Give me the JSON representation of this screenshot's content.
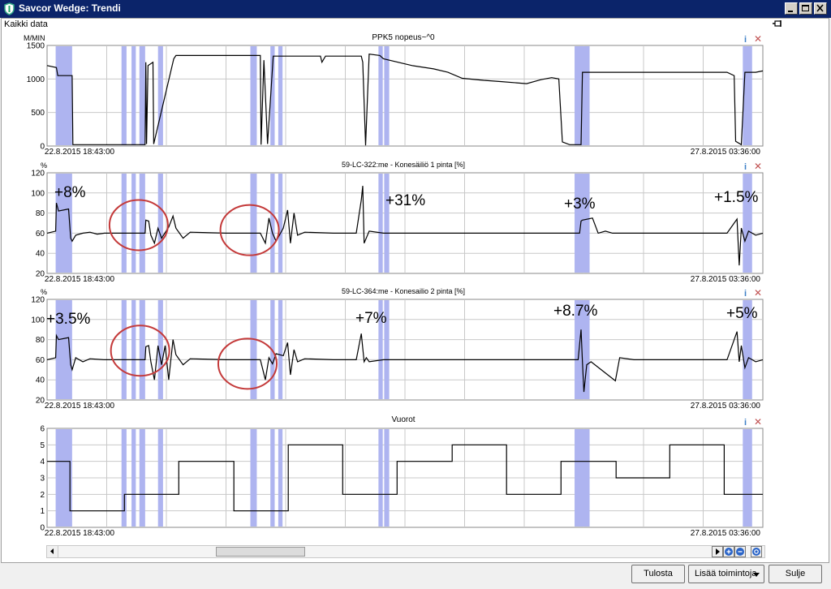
{
  "window": {
    "title": "Savcor Wedge: Trendi"
  },
  "header": {
    "data_label": "Kaikki data"
  },
  "charts": [
    {
      "title": "PPK5 nopeus~^0",
      "unit": "M/MIN",
      "yticks": [
        "1500",
        "1000",
        "500",
        "0"
      ],
      "ymin": 0,
      "ymax": 1500,
      "x_start": "22.8.2015 18:43:00",
      "x_end": "27.8.2015 03:36:00",
      "annotations": []
    },
    {
      "title": "59-LC-322:me - Konesäiliö 1 pinta [%]",
      "unit": "%",
      "yticks": [
        "120",
        "100",
        "80",
        "60",
        "40",
        "20"
      ],
      "ymin": 20,
      "ymax": 120,
      "x_start": "22.8.2015 18:43:00",
      "x_end": "27.8.2015 03:36:00",
      "annotations": [
        "+8%",
        "+31%",
        "+3%",
        "+1.5%"
      ]
    },
    {
      "title": "59-LC-364:me - Konesailio 2 pinta [%]",
      "unit": "%",
      "yticks": [
        "120",
        "100",
        "80",
        "60",
        "40",
        "20"
      ],
      "ymin": 20,
      "ymax": 120,
      "x_start": "22.8.2015 18:43:00",
      "x_end": "27.8.2015 03:36:00",
      "annotations": [
        "+3.5%",
        "+7%",
        "+8.7%",
        "+5%"
      ]
    },
    {
      "title": "Vuorot",
      "unit": "",
      "yticks": [
        "6",
        "5",
        "4",
        "3",
        "2",
        "1",
        "0"
      ],
      "ymin": 0,
      "ymax": 6,
      "x_start": "22.8.2015 18:43:00",
      "x_end": "27.8.2015 03:36:00",
      "annotations": []
    }
  ],
  "chart_data": [
    {
      "type": "line",
      "title": "PPK5 nopeus~^0",
      "ylabel": "M/MIN",
      "ylim": [
        0,
        1500
      ],
      "x_range": [
        "22.8.2015 18:43:00",
        "27.8.2015 03:36:00"
      ],
      "x": [
        0,
        1.3,
        1.5,
        3.5,
        3.6,
        13.7,
        13.8,
        13.9,
        14.1,
        14.8,
        14.9,
        17.7,
        18,
        29.8,
        29.9,
        30.3,
        30.8,
        31.6,
        38.2,
        38.4,
        38.9,
        43.9,
        44.1,
        44.5,
        45,
        46.5,
        47,
        51,
        54,
        56,
        58,
        61,
        63.5,
        67,
        69,
        70.5,
        71.5,
        72,
        73,
        74.6,
        74.8,
        75.1,
        95,
        96,
        96.2,
        97,
        97.5,
        99,
        100
      ],
      "y": [
        1200,
        1170,
        1050,
        1050,
        20,
        20,
        1250,
        30,
        1200,
        1250,
        30,
        1300,
        1350,
        1350,
        20,
        1280,
        30,
        1340,
        1340,
        1250,
        1340,
        1340,
        1250,
        10,
        1370,
        1350,
        1300,
        1200,
        1150,
        1100,
        1010,
        980,
        960,
        930,
        990,
        1020,
        1000,
        60,
        20,
        20,
        1100,
        1100,
        1100,
        1050,
        70,
        20,
        1100,
        1100,
        1120
      ]
    },
    {
      "type": "line",
      "title": "59-LC-322:me - Konesäiliö 1 pinta [%]",
      "ylabel": "%",
      "ylim": [
        20,
        120
      ],
      "x_range": [
        "22.8.2015 18:43:00",
        "27.8.2015 03:36:00"
      ],
      "x": [
        0,
        1.2,
        1.3,
        1.6,
        3,
        3.3,
        3.5,
        4,
        5,
        6,
        7,
        8,
        10,
        13.7,
        13.8,
        14.2,
        14.5,
        15,
        15.5,
        16,
        17,
        17.6,
        18,
        19,
        20,
        25,
        29.8,
        30.5,
        31,
        31.5,
        32,
        33,
        33.6,
        34,
        34.5,
        35,
        36,
        40,
        43.2,
        43.9,
        44.1,
        44.3,
        45,
        47,
        60,
        74.4,
        74.6,
        74.8,
        76.2,
        77,
        78,
        79,
        95,
        96.4,
        96.7,
        97,
        97.5,
        98,
        99,
        100
      ],
      "y": [
        60,
        62,
        90,
        82,
        84,
        55,
        52,
        58,
        60,
        61,
        59,
        60,
        60,
        60,
        73,
        72,
        58,
        50,
        65,
        55,
        66,
        77,
        65,
        55,
        61,
        60,
        60,
        50,
        75,
        60,
        52,
        65,
        83,
        50,
        80,
        58,
        61,
        60,
        60,
        93,
        107,
        50,
        62,
        60,
        60,
        60,
        72,
        73,
        75,
        60,
        62,
        60,
        60,
        74,
        28,
        65,
        52,
        62,
        58,
        60
      ],
      "annotations": [
        "+8%",
        "+31%",
        "+3%",
        "+1.5%"
      ]
    },
    {
      "type": "line",
      "title": "59-LC-364:me - Konesailio 2 pinta [%]",
      "ylabel": "%",
      "ylim": [
        20,
        120
      ],
      "x_range": [
        "22.8.2015 18:43:00",
        "27.8.2015 03:36:00"
      ],
      "x": [
        0,
        1.2,
        1.3,
        1.6,
        3,
        3.3,
        3.5,
        4,
        5,
        6,
        8,
        10,
        13.7,
        13.8,
        14.2,
        14.5,
        15,
        15.5,
        16,
        16.5,
        17,
        17.6,
        18,
        19,
        20,
        25,
        29.8,
        30.5,
        31,
        31.5,
        32,
        33,
        33.6,
        34,
        34.5,
        35,
        36,
        40,
        43.2,
        43.9,
        44.3,
        44.6,
        45,
        47,
        60,
        74.2,
        74.6,
        74.8,
        75,
        75.4,
        76,
        79.4,
        80,
        82,
        95,
        96.4,
        96.7,
        97,
        97.5,
        98,
        99,
        100
      ],
      "y": [
        60,
        62,
        84,
        80,
        82,
        55,
        50,
        62,
        58,
        61,
        60,
        60,
        60,
        73,
        74,
        58,
        40,
        74,
        55,
        74,
        40,
        80,
        65,
        55,
        61,
        60,
        60,
        40,
        62,
        56,
        66,
        64,
        77,
        45,
        70,
        58,
        61,
        60,
        60,
        86,
        58,
        62,
        58,
        60,
        60,
        60,
        90,
        58,
        28,
        55,
        58,
        39,
        62,
        60,
        60,
        88,
        58,
        74,
        52,
        62,
        58,
        60
      ],
      "annotations": [
        "+3.5%",
        "+7%",
        "+8.7%",
        "+5%"
      ]
    },
    {
      "type": "line",
      "title": "Vuorot",
      "ylim": [
        0,
        6
      ],
      "x_range": [
        "22.8.2015 18:43:00",
        "27.8.2015 03:36:00"
      ],
      "x": [
        0,
        3.2,
        3.2,
        10.8,
        10.8,
        18.4,
        18.4,
        26.1,
        26.1,
        33.7,
        33.7,
        41.3,
        41.3,
        48.9,
        48.9,
        56.6,
        56.6,
        64.2,
        64.2,
        71.8,
        71.8,
        79.5,
        79.5,
        87,
        87,
        94.6,
        94.6,
        100
      ],
      "y": [
        4,
        4,
        1,
        1,
        2,
        2,
        4,
        4,
        1,
        1,
        5,
        5,
        2,
        2,
        4,
        4,
        5,
        5,
        2,
        2,
        4,
        4,
        3,
        3,
        5,
        5,
        2,
        2
      ]
    }
  ],
  "bands": [
    [
      1.2,
      3.5
    ],
    [
      10.4,
      11.1
    ],
    [
      11.8,
      12.4
    ],
    [
      12.9,
      13.7
    ],
    [
      15.5,
      16.2
    ],
    [
      28.4,
      29.3
    ],
    [
      31.2,
      31.8
    ],
    [
      32.3,
      32.9
    ],
    [
      46.3,
      46.9
    ],
    [
      47.1,
      47.8
    ],
    [
      73.7,
      75.8
    ],
    [
      97.2,
      98.5
    ]
  ],
  "colors": {
    "band": "#aeb4f0",
    "titlebar": "#0b246a",
    "grid": "#c8c8c8",
    "annotation_circle": "#c43a3a",
    "info_icon": "#3e7fc7",
    "close_icon": "#c05050"
  },
  "circles": [
    {
      "chart": 1,
      "x": 12.8,
      "y": 68
    },
    {
      "chart": 1,
      "x": 28.3,
      "y": 63
    },
    {
      "chart": 2,
      "x": 13.0,
      "y": 69
    },
    {
      "chart": 2,
      "x": 28.0,
      "y": 56
    }
  ],
  "footer": {
    "print_label": "Tulosta",
    "more_label": "Lisää toimintoja",
    "close_label": "Sulje"
  }
}
